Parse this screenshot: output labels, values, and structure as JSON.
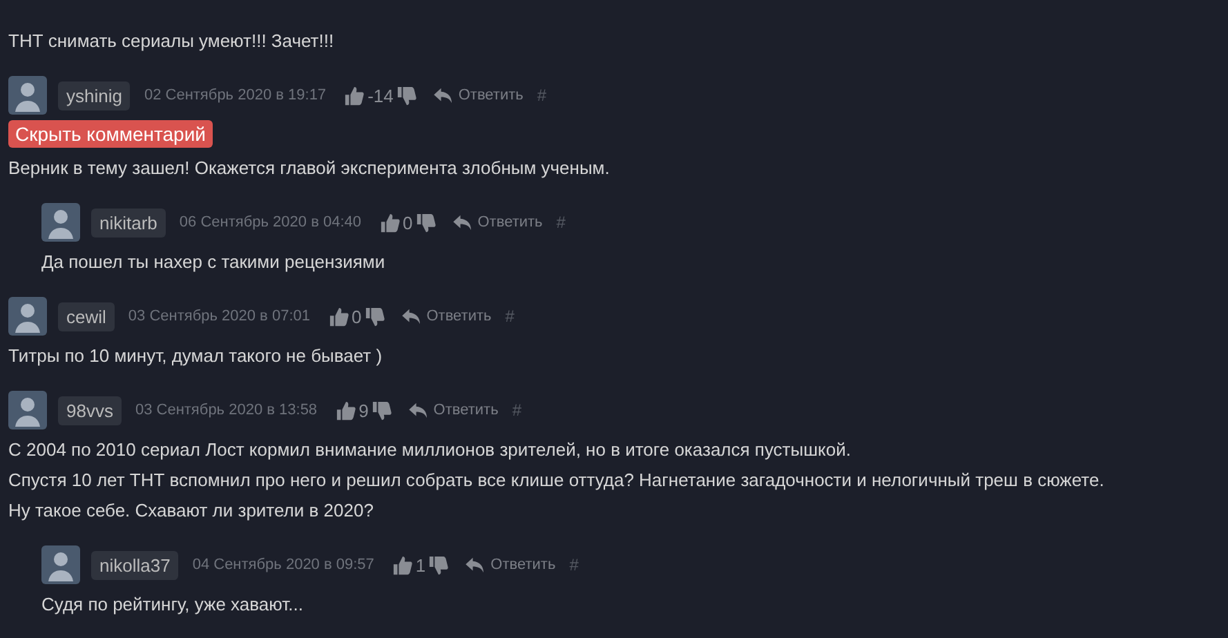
{
  "comments": [
    {
      "text": [
        "ТНТ снимать сериалы умеют!!! Зачет!!!"
      ]
    },
    {
      "user": "yshinig",
      "date": "02 Сентябрь 2020 в 19:17",
      "score": "-14",
      "reply": "Ответить",
      "anchor": "#",
      "hide_button": "Скрыть комментарий",
      "text": [
        "Верник в тему зашел! Окажется главой эксперимента злобным ученым."
      ],
      "children": [
        {
          "user": "nikitarb",
          "date": "06 Сентябрь 2020 в 04:40",
          "score": "0",
          "reply": "Ответить",
          "anchor": "#",
          "text": [
            "Да пошел ты нахер с такими рецензиями"
          ]
        }
      ]
    },
    {
      "user": "cewil",
      "date": "03 Сентябрь 2020 в 07:01",
      "score": "0",
      "reply": "Ответить",
      "anchor": "#",
      "text": [
        "Титры по 10 минут, думал такого не бывает )"
      ]
    },
    {
      "user": "98vvs",
      "date": "03 Сентябрь 2020 в 13:58",
      "score": "9",
      "reply": "Ответить",
      "anchor": "#",
      "text": [
        "С 2004 по 2010 сериал Лост кормил внимание миллионов зрителей, но в итоге оказался пустышкой.",
        "Спустя 10 лет ТНТ вспомнил про него и решил собрать все клише оттуда? Нагнетание загадочности и нелогичный треш в сюжете.",
        "Ну такое себе. Схавают ли зрители в 2020?"
      ],
      "children": [
        {
          "user": "nikolla37",
          "date": "04 Сентябрь 2020 в 09:57",
          "score": "1",
          "reply": "Ответить",
          "anchor": "#",
          "text": [
            "Судя по рейтингу, уже хавают..."
          ]
        }
      ]
    }
  ]
}
